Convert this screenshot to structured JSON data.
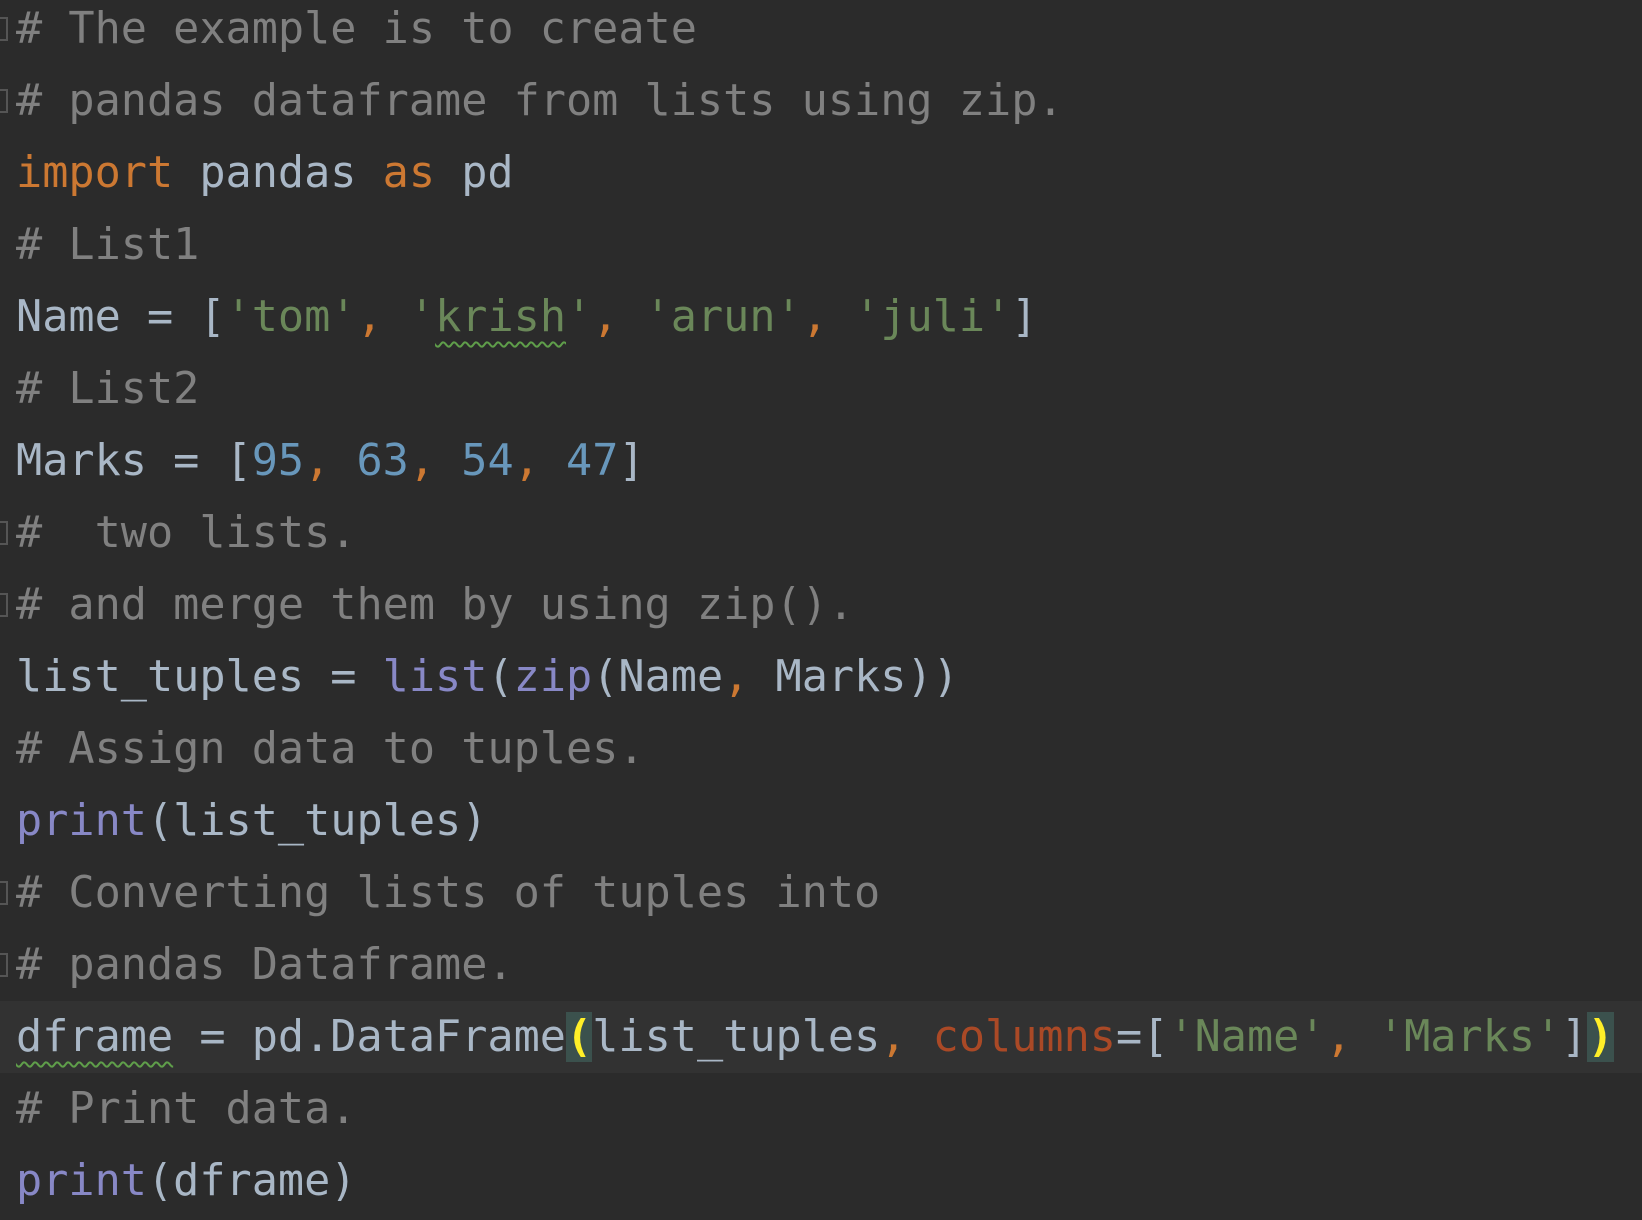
{
  "editor": {
    "colors": {
      "background": "#2b2b2b",
      "current_line": "#323232",
      "comment": "#808080",
      "keyword": "#cc7832",
      "identifier": "#a9b7c6",
      "string": "#6a8759",
      "number": "#6897bb",
      "builtin": "#8888c6",
      "keyword_arg": "#aa4926",
      "brace_match": "#ffef28"
    },
    "current_line_index": 14,
    "lines": [
      {
        "fold": true,
        "tokens": [
          [
            "# The example is to create",
            "c"
          ]
        ]
      },
      {
        "fold": true,
        "tokens": [
          [
            "# pandas dataframe from lists using zip.",
            "c"
          ]
        ]
      },
      {
        "tokens": [
          [
            "import",
            "k"
          ],
          [
            " pandas ",
            "d"
          ],
          [
            "as",
            "k"
          ],
          [
            " pd",
            "d"
          ]
        ]
      },
      {
        "tokens": [
          [
            "# List1",
            "c"
          ]
        ]
      },
      {
        "tokens": [
          [
            "Name = [",
            "d"
          ],
          [
            "'tom'",
            "s"
          ],
          [
            ", ",
            "m"
          ],
          [
            "'",
            "s"
          ],
          [
            "krish",
            "s warn"
          ],
          [
            "'",
            "s"
          ],
          [
            ", ",
            "m"
          ],
          [
            "'arun'",
            "s"
          ],
          [
            ", ",
            "m"
          ],
          [
            "'juli'",
            "s"
          ],
          [
            "]",
            "d"
          ]
        ]
      },
      {
        "tokens": [
          [
            "# List2",
            "c"
          ]
        ]
      },
      {
        "tokens": [
          [
            "Marks = [",
            "d"
          ],
          [
            "95",
            "n"
          ],
          [
            ", ",
            "m"
          ],
          [
            "63",
            "n"
          ],
          [
            ", ",
            "m"
          ],
          [
            "54",
            "n"
          ],
          [
            ", ",
            "m"
          ],
          [
            "47",
            "n"
          ],
          [
            "]",
            "d"
          ]
        ]
      },
      {
        "fold": true,
        "tokens": [
          [
            "#  two lists.",
            "c"
          ]
        ]
      },
      {
        "fold": true,
        "tokens": [
          [
            "# and merge them by using zip().",
            "c"
          ]
        ]
      },
      {
        "tokens": [
          [
            "list_tuples = ",
            "d"
          ],
          [
            "list",
            "b"
          ],
          [
            "(",
            "d"
          ],
          [
            "zip",
            "b"
          ],
          [
            "(Name",
            "d"
          ],
          [
            ", ",
            "m"
          ],
          [
            "Marks))",
            "d"
          ]
        ]
      },
      {
        "tokens": [
          [
            "# Assign data to tuples.",
            "c"
          ]
        ]
      },
      {
        "tokens": [
          [
            "print",
            "b"
          ],
          [
            "(list_tuples)",
            "d"
          ]
        ]
      },
      {
        "fold": true,
        "tokens": [
          [
            "# Converting lists of tuples into",
            "c"
          ]
        ]
      },
      {
        "fold": true,
        "tokens": [
          [
            "# pandas Dataframe.",
            "c"
          ]
        ]
      },
      {
        "tokens": [
          [
            "dframe",
            "d warn"
          ],
          [
            " = pd.DataFrame",
            "d"
          ],
          [
            "(",
            "brace"
          ],
          [
            "list_tuples",
            "d"
          ],
          [
            ", ",
            "m"
          ],
          [
            "columns",
            "p"
          ],
          [
            "=[",
            "d"
          ],
          [
            "'Name'",
            "s"
          ],
          [
            ", ",
            "m"
          ],
          [
            "'Marks'",
            "s"
          ],
          [
            "]",
            "d"
          ],
          [
            ")",
            "brace"
          ]
        ]
      },
      {
        "tokens": [
          [
            "# Print data.",
            "c"
          ]
        ]
      },
      {
        "tokens": [
          [
            "print",
            "b"
          ],
          [
            "(dframe)",
            "d"
          ]
        ]
      }
    ]
  }
}
